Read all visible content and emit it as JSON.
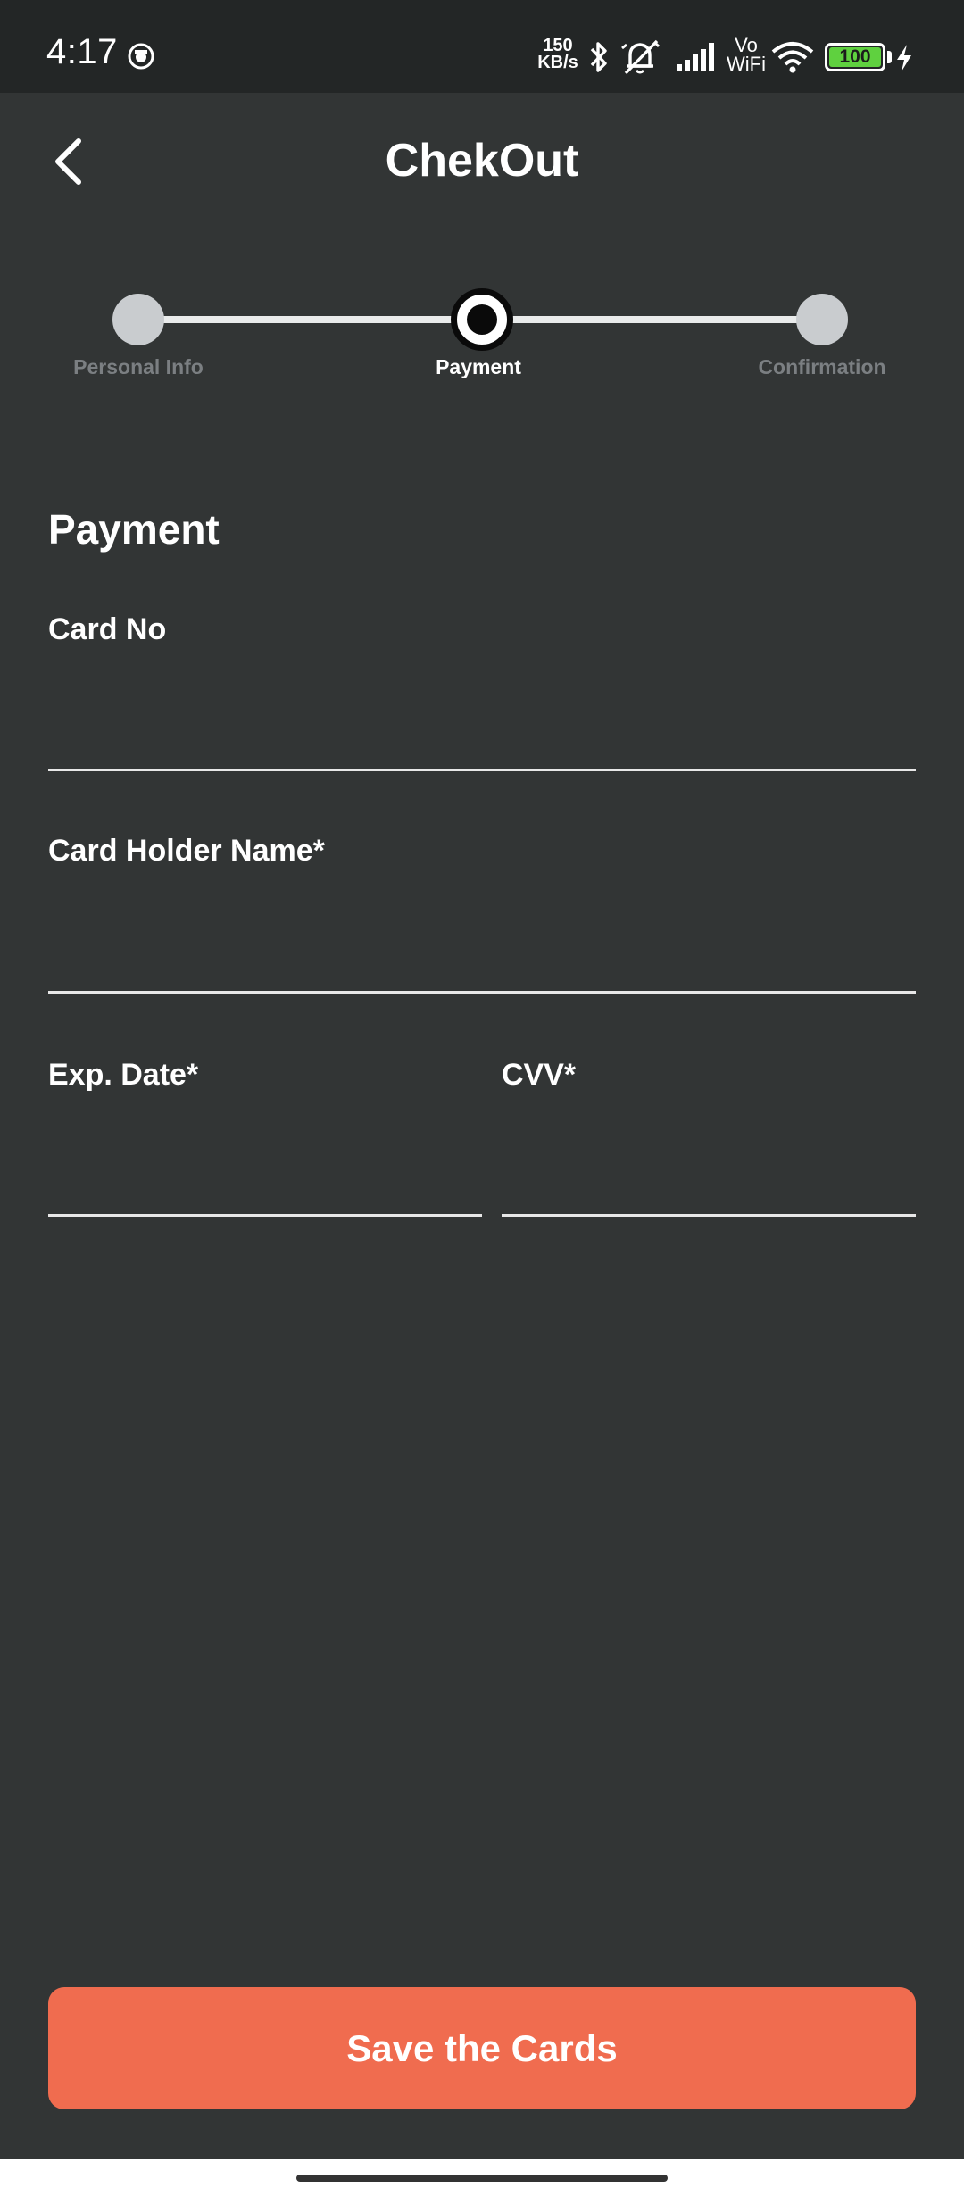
{
  "status_bar": {
    "time": "4:17",
    "net_speed_value": "150",
    "net_speed_unit": "KB/s",
    "vowifi_top": "Vo",
    "vowifi_bottom": "WiFi",
    "battery_level": "100",
    "icons": [
      "app-notification-icon",
      "bluetooth-icon",
      "mute-icon",
      "signal-icon",
      "wifi-icon",
      "battery-icon",
      "charging-icon"
    ]
  },
  "header": {
    "title": "ChekOut",
    "back_icon": "chevron-left-icon"
  },
  "stepper": {
    "steps": [
      {
        "label": "Personal Info",
        "state": "inactive"
      },
      {
        "label": "Payment",
        "state": "active"
      },
      {
        "label": "Confirmation",
        "state": "inactive"
      }
    ]
  },
  "form": {
    "section_title": "Payment",
    "card_no": {
      "label": "Card No",
      "value": ""
    },
    "card_holder": {
      "label": "Card Holder Name*",
      "value": ""
    },
    "exp_date": {
      "label": "Exp. Date*",
      "value": ""
    },
    "cvv": {
      "label": "CVV*",
      "value": ""
    }
  },
  "actions": {
    "save_label": "Save the Cards"
  },
  "colors": {
    "background": "#323535",
    "status_bar": "#232626",
    "accent_button": "#f06c4f",
    "battery_green": "#5fd13f"
  }
}
